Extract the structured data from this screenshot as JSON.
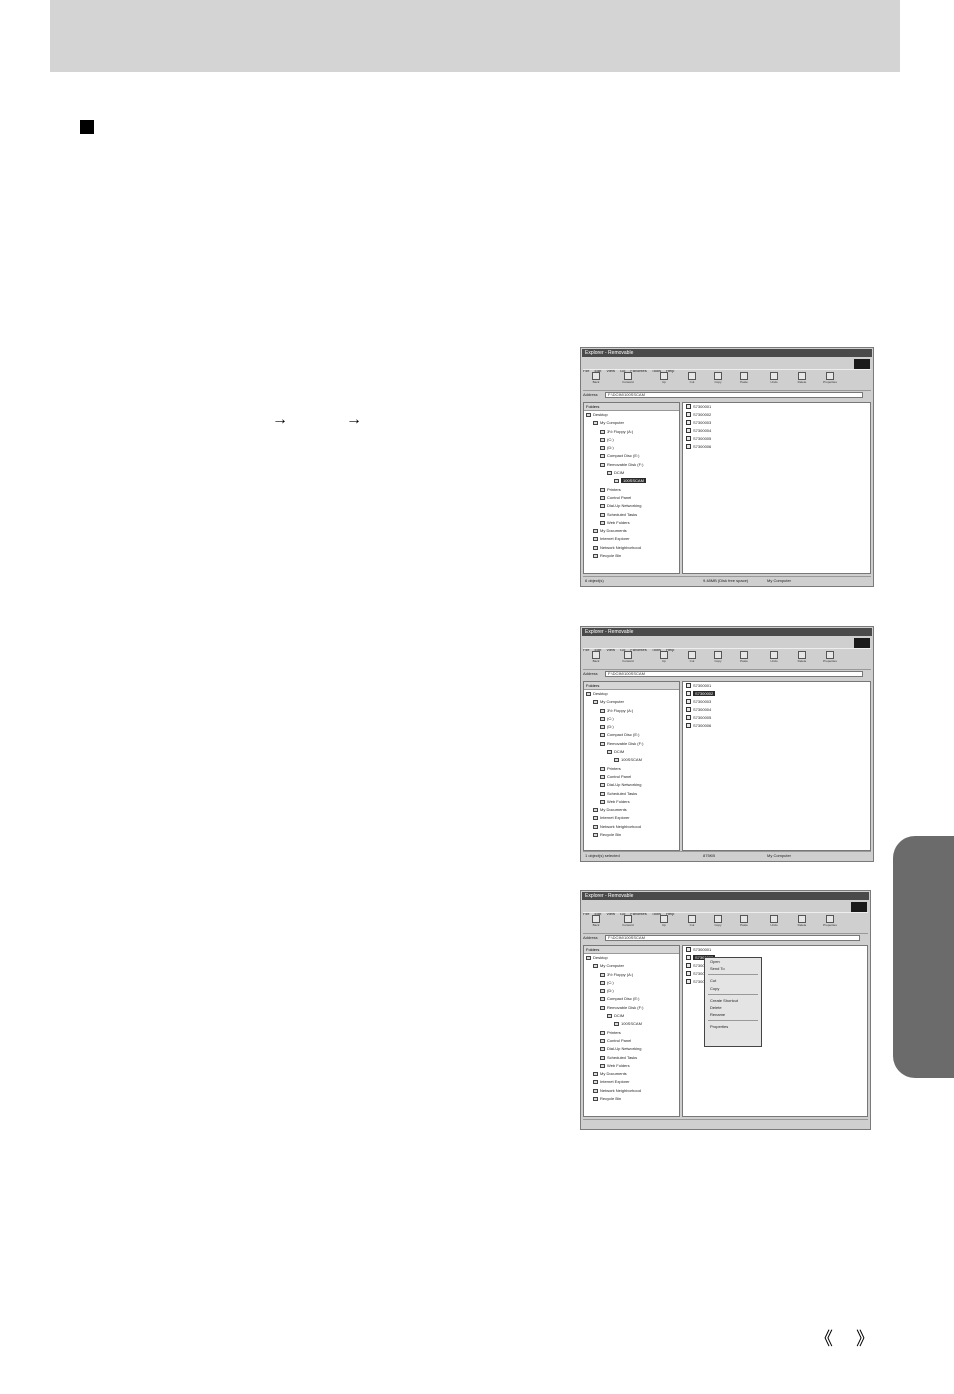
{
  "page": {
    "arrow_1": "→",
    "arrow_2": "→",
    "nav_prev": "《",
    "nav_next": "》"
  },
  "screenshots": [
    {
      "title": "Explorer - Removable",
      "menu": [
        "File",
        "Edit",
        "View",
        "Go",
        "Favorites",
        "Tools",
        "Help"
      ],
      "toolbar": [
        "Back",
        "Forward",
        "Up",
        "Cut",
        "Copy",
        "Paste",
        "Undo",
        "Delete",
        "Properties"
      ],
      "address_label": "Address",
      "address_value": "F:\\DCIM\\100SSCAM",
      "tree_header": "Folders",
      "tree": [
        {
          "label": "Desktop",
          "level": 0
        },
        {
          "label": "My Computer",
          "level": 1
        },
        {
          "label": "3½ Floppy (A:)",
          "level": 2
        },
        {
          "label": "(C:)",
          "level": 2
        },
        {
          "label": "(D:)",
          "level": 2
        },
        {
          "label": "Compact Disc (E:)",
          "level": 2
        },
        {
          "label": "Removable Disk (F:)",
          "level": 2
        },
        {
          "label": "DCIM",
          "level": 3
        },
        {
          "label": "100SSCAM",
          "level": 4,
          "selected": true
        },
        {
          "label": "Printers",
          "level": 2
        },
        {
          "label": "Control Panel",
          "level": 2
        },
        {
          "label": "Dial-Up Networking",
          "level": 2
        },
        {
          "label": "Scheduled Tasks",
          "level": 2
        },
        {
          "label": "Web Folders",
          "level": 2
        },
        {
          "label": "My Documents",
          "level": 1
        },
        {
          "label": "Internet Explorer",
          "level": 1
        },
        {
          "label": "Network Neighborhood",
          "level": 1
        },
        {
          "label": "Recycle Bin",
          "level": 1
        }
      ],
      "files": [
        {
          "name": "S7300001"
        },
        {
          "name": "S7300002"
        },
        {
          "name": "S7300003"
        },
        {
          "name": "S7300004"
        },
        {
          "name": "S7300005"
        },
        {
          "name": "S7300006"
        }
      ],
      "status": [
        "6 object(s)",
        "9.48MB (Disk free space)",
        "My Computer"
      ]
    },
    {
      "title": "Explorer - Removable",
      "menu": [
        "File",
        "Edit",
        "View",
        "Go",
        "Favorites",
        "Tools",
        "Help"
      ],
      "toolbar": [
        "Back",
        "Forward",
        "Up",
        "Cut",
        "Copy",
        "Paste",
        "Undo",
        "Delete",
        "Properties"
      ],
      "address_label": "Address",
      "address_value": "F:\\DCIM\\100SSCAM",
      "tree_header": "Folders",
      "tree": [
        {
          "label": "Desktop",
          "level": 0
        },
        {
          "label": "My Computer",
          "level": 1
        },
        {
          "label": "3½ Floppy (A:)",
          "level": 2
        },
        {
          "label": "(C:)",
          "level": 2
        },
        {
          "label": "(D:)",
          "level": 2
        },
        {
          "label": "Compact Disc (E:)",
          "level": 2
        },
        {
          "label": "Removable Disk (F:)",
          "level": 2
        },
        {
          "label": "DCIM",
          "level": 3
        },
        {
          "label": "100SSCAM",
          "level": 4
        },
        {
          "label": "Printers",
          "level": 2
        },
        {
          "label": "Control Panel",
          "level": 2
        },
        {
          "label": "Dial-Up Networking",
          "level": 2
        },
        {
          "label": "Scheduled Tasks",
          "level": 2
        },
        {
          "label": "Web Folders",
          "level": 2
        },
        {
          "label": "My Documents",
          "level": 1
        },
        {
          "label": "Internet Explorer",
          "level": 1
        },
        {
          "label": "Network Neighborhood",
          "level": 1
        },
        {
          "label": "Recycle Bin",
          "level": 1
        }
      ],
      "files": [
        {
          "name": "S7300001"
        },
        {
          "name": "S7300002",
          "selected": true
        },
        {
          "name": "S7300003"
        },
        {
          "name": "S7300004"
        },
        {
          "name": "S7300005"
        },
        {
          "name": "S7300006"
        }
      ],
      "status": [
        "1 object(s) selected",
        "875KB",
        "My Computer"
      ]
    },
    {
      "title": "Explorer - Removable",
      "menu": [
        "File",
        "Edit",
        "View",
        "Go",
        "Favorites",
        "Tools",
        "Help"
      ],
      "toolbar": [
        "Back",
        "Forward",
        "Up",
        "Cut",
        "Copy",
        "Paste",
        "Undo",
        "Delete",
        "Properties"
      ],
      "address_label": "Address",
      "address_value": "F:\\DCIM\\100SSCAM",
      "tree_header": "Folders",
      "tree": [
        {
          "label": "Desktop",
          "level": 0
        },
        {
          "label": "My Computer",
          "level": 1
        },
        {
          "label": "3½ Floppy (A:)",
          "level": 2
        },
        {
          "label": "(C:)",
          "level": 2
        },
        {
          "label": "(D:)",
          "level": 2
        },
        {
          "label": "Compact Disc (E:)",
          "level": 2
        },
        {
          "label": "Removable Disk (F:)",
          "level": 2
        },
        {
          "label": "DCIM",
          "level": 3
        },
        {
          "label": "100SSCAM",
          "level": 4
        },
        {
          "label": "Printers",
          "level": 2
        },
        {
          "label": "Control Panel",
          "level": 2
        },
        {
          "label": "Dial-Up Networking",
          "level": 2
        },
        {
          "label": "Scheduled Tasks",
          "level": 2
        },
        {
          "label": "Web Folders",
          "level": 2
        },
        {
          "label": "My Documents",
          "level": 1
        },
        {
          "label": "Internet Explorer",
          "level": 1
        },
        {
          "label": "Network Neighborhood",
          "level": 1
        },
        {
          "label": "Recycle Bin",
          "level": 1
        }
      ],
      "files": [
        {
          "name": "S7300001"
        },
        {
          "name": "S7300002",
          "selected": true
        },
        {
          "name": "S7300003"
        },
        {
          "name": "S7300004"
        },
        {
          "name": "S7300005"
        }
      ],
      "context_menu": [
        "Open",
        "Send To",
        "",
        "Cut",
        "Copy",
        "",
        "Create Shortcut",
        "Delete",
        "Rename",
        "",
        "Properties"
      ],
      "status": [
        "",
        "",
        ""
      ]
    }
  ]
}
